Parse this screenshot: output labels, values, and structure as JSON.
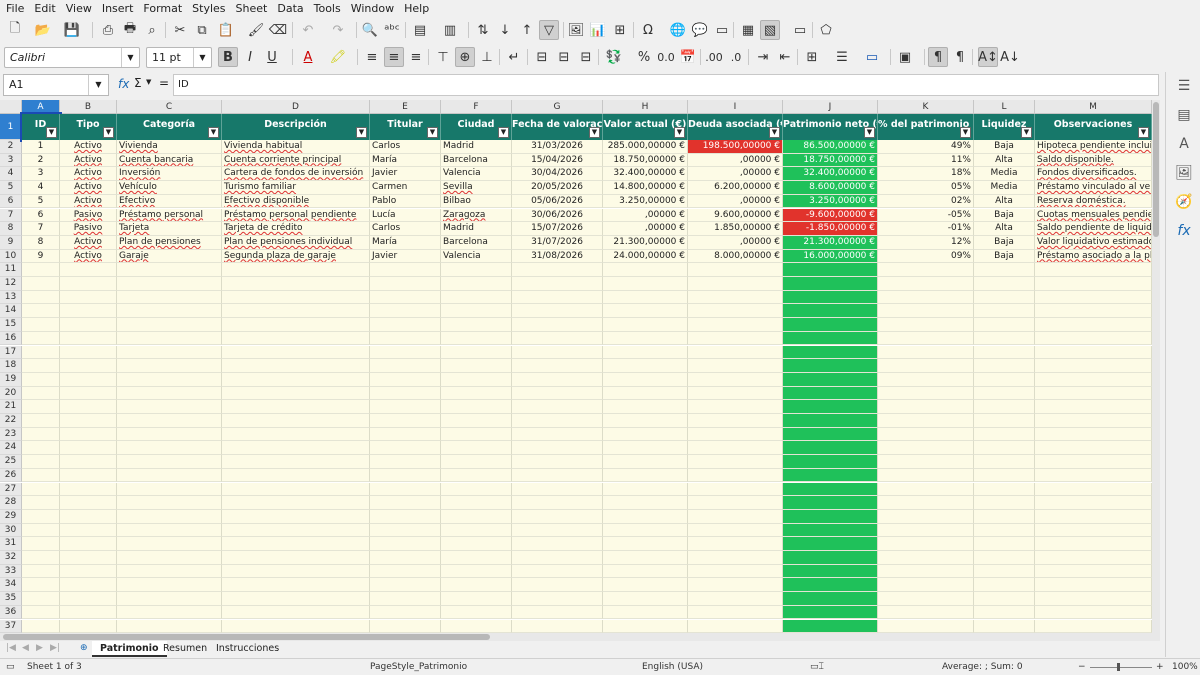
{
  "menu": [
    "File",
    "Edit",
    "View",
    "Insert",
    "Format",
    "Styles",
    "Sheet",
    "Data",
    "Tools",
    "Window",
    "Help"
  ],
  "font": {
    "name": "Calibri",
    "size": "11 pt"
  },
  "formula": {
    "cell_ref": "A1",
    "content": "ID"
  },
  "columns": [
    "A",
    "B",
    "C",
    "D",
    "E",
    "F",
    "G",
    "H",
    "I",
    "J",
    "K",
    "L",
    "M"
  ],
  "headers": [
    "ID",
    "Tipo",
    "Categoría",
    "Descripción",
    "Titular",
    "Ciudad",
    "Fecha de valoración",
    "Valor actual (€)",
    "Deuda asociada (€)",
    "Patrimonio neto (€)",
    "% del patrimonio neto",
    "Liquidez",
    "Observaciones"
  ],
  "rows": [
    [
      "1",
      "Activo",
      "Vivienda",
      "Vivienda habitual",
      "Carlos",
      "Madrid",
      "31/03/2026",
      "285.000,00000 €",
      "198.500,00000 €",
      "86.500,00000 €",
      "49%",
      "Baja",
      "Hipoteca pendiente incluida."
    ],
    [
      "2",
      "Activo",
      "Cuenta bancaria",
      "Cuenta corriente principal",
      "María",
      "Barcelona",
      "15/04/2026",
      "18.750,00000 €",
      ",00000 €",
      "18.750,00000 €",
      "11%",
      "Alta",
      "Saldo disponible."
    ],
    [
      "3",
      "Activo",
      "Inversión",
      "Cartera de fondos de inversión",
      "Javier",
      "Valencia",
      "30/04/2026",
      "32.400,00000 €",
      ",00000 €",
      "32.400,00000 €",
      "18%",
      "Media",
      "Fondos diversificados."
    ],
    [
      "4",
      "Activo",
      "Vehículo",
      "Turismo familiar",
      "Carmen",
      "Sevilla",
      "20/05/2026",
      "14.800,00000 €",
      "6.200,00000 €",
      "8.600,00000 €",
      "05%",
      "Media",
      "Préstamo vinculado al vehículo."
    ],
    [
      "5",
      "Activo",
      "Efectivo",
      "Efectivo disponible",
      "Pablo",
      "Bilbao",
      "05/06/2026",
      "3.250,00000 €",
      ",00000 €",
      "3.250,00000 €",
      "02%",
      "Alta",
      "Reserva doméstica."
    ],
    [
      "6",
      "Pasivo",
      "Préstamo personal",
      "Préstamo personal pendiente",
      "Lucía",
      "Zaragoza",
      "30/06/2026",
      ",00000 €",
      "9.600,00000 €",
      "-9.600,00000 €",
      "-05%",
      "Baja",
      "Cuotas mensuales pendientes."
    ],
    [
      "7",
      "Pasivo",
      "Tarjeta",
      "Tarjeta de crédito",
      "Carlos",
      "Madrid",
      "15/07/2026",
      ",00000 €",
      "1.850,00000 €",
      "-1.850,00000 €",
      "-01%",
      "Alta",
      "Saldo pendiente de liquidación."
    ],
    [
      "8",
      "Activo",
      "Plan de pensiones",
      "Plan de pensiones individual",
      "María",
      "Barcelona",
      "31/07/2026",
      "21.300,00000 €",
      ",00000 €",
      "21.300,00000 €",
      "12%",
      "Baja",
      "Valor liquidativo estimado."
    ],
    [
      "9",
      "Activo",
      "Garaje",
      "Segunda plaza de garaje",
      "Javier",
      "Valencia",
      "31/08/2026",
      "24.000,00000 €",
      "8.000,00000 €",
      "16.000,00000 €",
      "09%",
      "Baja",
      "Préstamo asociado a la plaza."
    ]
  ],
  "row_numbers": [
    "1",
    "2",
    "3",
    "4",
    "5",
    "6",
    "7",
    "8",
    "9",
    "10",
    "11",
    "12",
    "13",
    "14",
    "15",
    "16",
    "17",
    "18",
    "19",
    "20",
    "21",
    "22",
    "23",
    "24",
    "25",
    "26",
    "27",
    "28",
    "29",
    "30",
    "31",
    "32",
    "33",
    "34",
    "35",
    "36",
    "37"
  ],
  "sheets": [
    "Patrimonio",
    "Resumen",
    "Instrucciones"
  ],
  "status": {
    "sheet": "Sheet 1 of 3",
    "page_style": "PageStyle_Patrimonio",
    "language": "English (USA)",
    "summary": "Average: ; Sum: 0",
    "zoom": "100%"
  },
  "colors": {
    "header": "#17786a",
    "negative": "#e1332c",
    "positive": "#1fc15a",
    "cell_bg": "#fdfbe6"
  }
}
